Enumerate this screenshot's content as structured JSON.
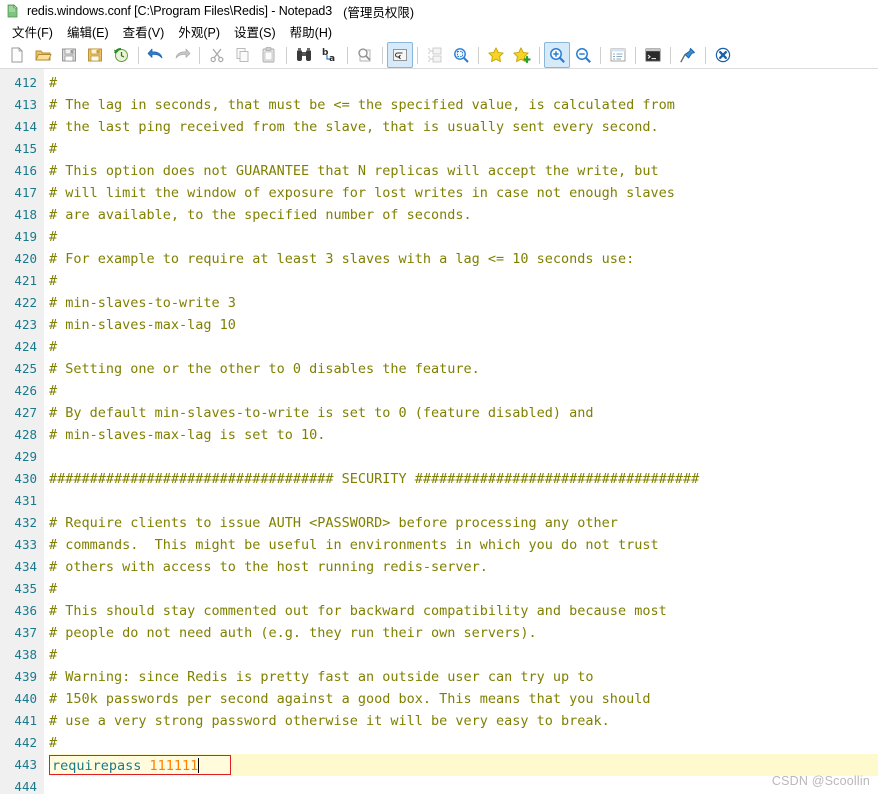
{
  "window": {
    "title": "redis.windows.conf [C:\\Program Files\\Redis] - Notepad3",
    "admin_suffix": "(管理员权限)",
    "icon": "notepad3-app-icon"
  },
  "menu": {
    "items": [
      {
        "label": "文件(F)",
        "name": "menu-file"
      },
      {
        "label": "编辑(E)",
        "name": "menu-edit"
      },
      {
        "label": "查看(V)",
        "name": "menu-view"
      },
      {
        "label": "外观(P)",
        "name": "menu-appearance"
      },
      {
        "label": "设置(S)",
        "name": "menu-settings"
      },
      {
        "label": "帮助(H)",
        "name": "menu-help"
      }
    ]
  },
  "toolbar": {
    "buttons": [
      {
        "name": "new-file-icon",
        "tip": "新建"
      },
      {
        "name": "open-folder-icon",
        "tip": "打开"
      },
      {
        "name": "save-icon",
        "tip": "保存"
      },
      {
        "name": "save-as-icon",
        "tip": "另存为"
      },
      {
        "name": "revert-clock-icon",
        "tip": "恢复"
      },
      {
        "sep": true
      },
      {
        "name": "undo-arrow-icon",
        "tip": "撤销"
      },
      {
        "name": "redo-arrow-icon",
        "tip": "重做"
      },
      {
        "sep": true
      },
      {
        "name": "cut-scissors-icon",
        "tip": "剪切"
      },
      {
        "name": "copy-icon",
        "tip": "复制"
      },
      {
        "name": "paste-icon",
        "tip": "粘贴"
      },
      {
        "sep": true
      },
      {
        "name": "find-binoculars-icon",
        "tip": "查找"
      },
      {
        "name": "replace-ba-icon",
        "tip": "替换"
      },
      {
        "sep": true
      },
      {
        "name": "zoom-page-icon",
        "tip": "查找下一个"
      },
      {
        "sep": true
      },
      {
        "name": "word-wrap-icon",
        "tip": "自动换行",
        "active": true
      },
      {
        "sep": true
      },
      {
        "name": "indent-guides-icon",
        "tip": "缩进参考线"
      },
      {
        "name": "zoom-select-icon",
        "tip": "选区缩放"
      },
      {
        "sep": true
      },
      {
        "name": "bookmark-star-icon",
        "tip": "书签"
      },
      {
        "name": "bookmark-add-star-icon",
        "tip": "添加书签"
      },
      {
        "sep": true
      },
      {
        "name": "zoom-in-icon",
        "tip": "放大",
        "active": true
      },
      {
        "name": "zoom-out-icon",
        "tip": "缩小"
      },
      {
        "sep": true
      },
      {
        "name": "scheme-list-icon",
        "tip": "语法方案"
      },
      {
        "sep": true
      },
      {
        "name": "console-icon",
        "tip": "控制台"
      },
      {
        "sep": true
      },
      {
        "name": "pin-always-on-top-icon",
        "tip": "置顶"
      },
      {
        "sep": true
      },
      {
        "name": "exit-close-icon",
        "tip": "退出"
      }
    ]
  },
  "editor": {
    "first_line_number": 412,
    "current_line_number": 443,
    "current_line_text_keyword": "requirepass",
    "current_line_text_value": "111111",
    "lines": [
      {
        "n": 412,
        "text": "#",
        "type": "comment"
      },
      {
        "n": 413,
        "text": "# The lag in seconds, that must be <= the specified value, is calculated from",
        "type": "comment"
      },
      {
        "n": 414,
        "text": "# the last ping received from the slave, that is usually sent every second.",
        "type": "comment"
      },
      {
        "n": 415,
        "text": "#",
        "type": "comment"
      },
      {
        "n": 416,
        "text": "# This option does not GUARANTEE that N replicas will accept the write, but",
        "type": "comment"
      },
      {
        "n": 417,
        "text": "# will limit the window of exposure for lost writes in case not enough slaves",
        "type": "comment"
      },
      {
        "n": 418,
        "text": "# are available, to the specified number of seconds.",
        "type": "comment"
      },
      {
        "n": 419,
        "text": "#",
        "type": "comment"
      },
      {
        "n": 420,
        "text": "# For example to require at least 3 slaves with a lag <= 10 seconds use:",
        "type": "comment"
      },
      {
        "n": 421,
        "text": "#",
        "type": "comment"
      },
      {
        "n": 422,
        "text": "# min-slaves-to-write 3",
        "type": "comment"
      },
      {
        "n": 423,
        "text": "# min-slaves-max-lag 10",
        "type": "comment"
      },
      {
        "n": 424,
        "text": "#",
        "type": "comment"
      },
      {
        "n": 425,
        "text": "# Setting one or the other to 0 disables the feature.",
        "type": "comment"
      },
      {
        "n": 426,
        "text": "#",
        "type": "comment"
      },
      {
        "n": 427,
        "text": "# By default min-slaves-to-write is set to 0 (feature disabled) and",
        "type": "comment"
      },
      {
        "n": 428,
        "text": "# min-slaves-max-lag is set to 10.",
        "type": "comment"
      },
      {
        "n": 429,
        "text": "",
        "type": "blank"
      },
      {
        "n": 430,
        "text": "################################### SECURITY ###################################",
        "type": "comment"
      },
      {
        "n": 431,
        "text": "",
        "type": "blank"
      },
      {
        "n": 432,
        "text": "# Require clients to issue AUTH <PASSWORD> before processing any other",
        "type": "comment"
      },
      {
        "n": 433,
        "text": "# commands.  This might be useful in environments in which you do not trust",
        "type": "comment"
      },
      {
        "n": 434,
        "text": "# others with access to the host running redis-server.",
        "type": "comment"
      },
      {
        "n": 435,
        "text": "#",
        "type": "comment"
      },
      {
        "n": 436,
        "text": "# This should stay commented out for backward compatibility and because most",
        "type": "comment"
      },
      {
        "n": 437,
        "text": "# people do not need auth (e.g. they run their own servers).",
        "type": "comment"
      },
      {
        "n": 438,
        "text": "#",
        "type": "comment"
      },
      {
        "n": 439,
        "text": "# Warning: since Redis is pretty fast an outside user can try up to",
        "type": "comment"
      },
      {
        "n": 440,
        "text": "# 150k passwords per second against a good box. This means that you should",
        "type": "comment"
      },
      {
        "n": 441,
        "text": "# use a very strong password otherwise it will be very easy to break.",
        "type": "comment"
      },
      {
        "n": 442,
        "text": "#",
        "type": "comment"
      },
      {
        "n": 443,
        "text": "requirepass 111111",
        "type": "current"
      },
      {
        "n": 444,
        "text": "",
        "type": "blank"
      }
    ]
  },
  "watermark": "CSDN @Scoollin",
  "colors": {
    "comment": "#808000",
    "keyword": "#1a7a8c",
    "number": "#ff8000",
    "linenumber": "#1a7a8c",
    "gutter_bg": "#f0f0f0",
    "current_line_bg": "#fffacd",
    "current_box_border": "#e02020"
  }
}
